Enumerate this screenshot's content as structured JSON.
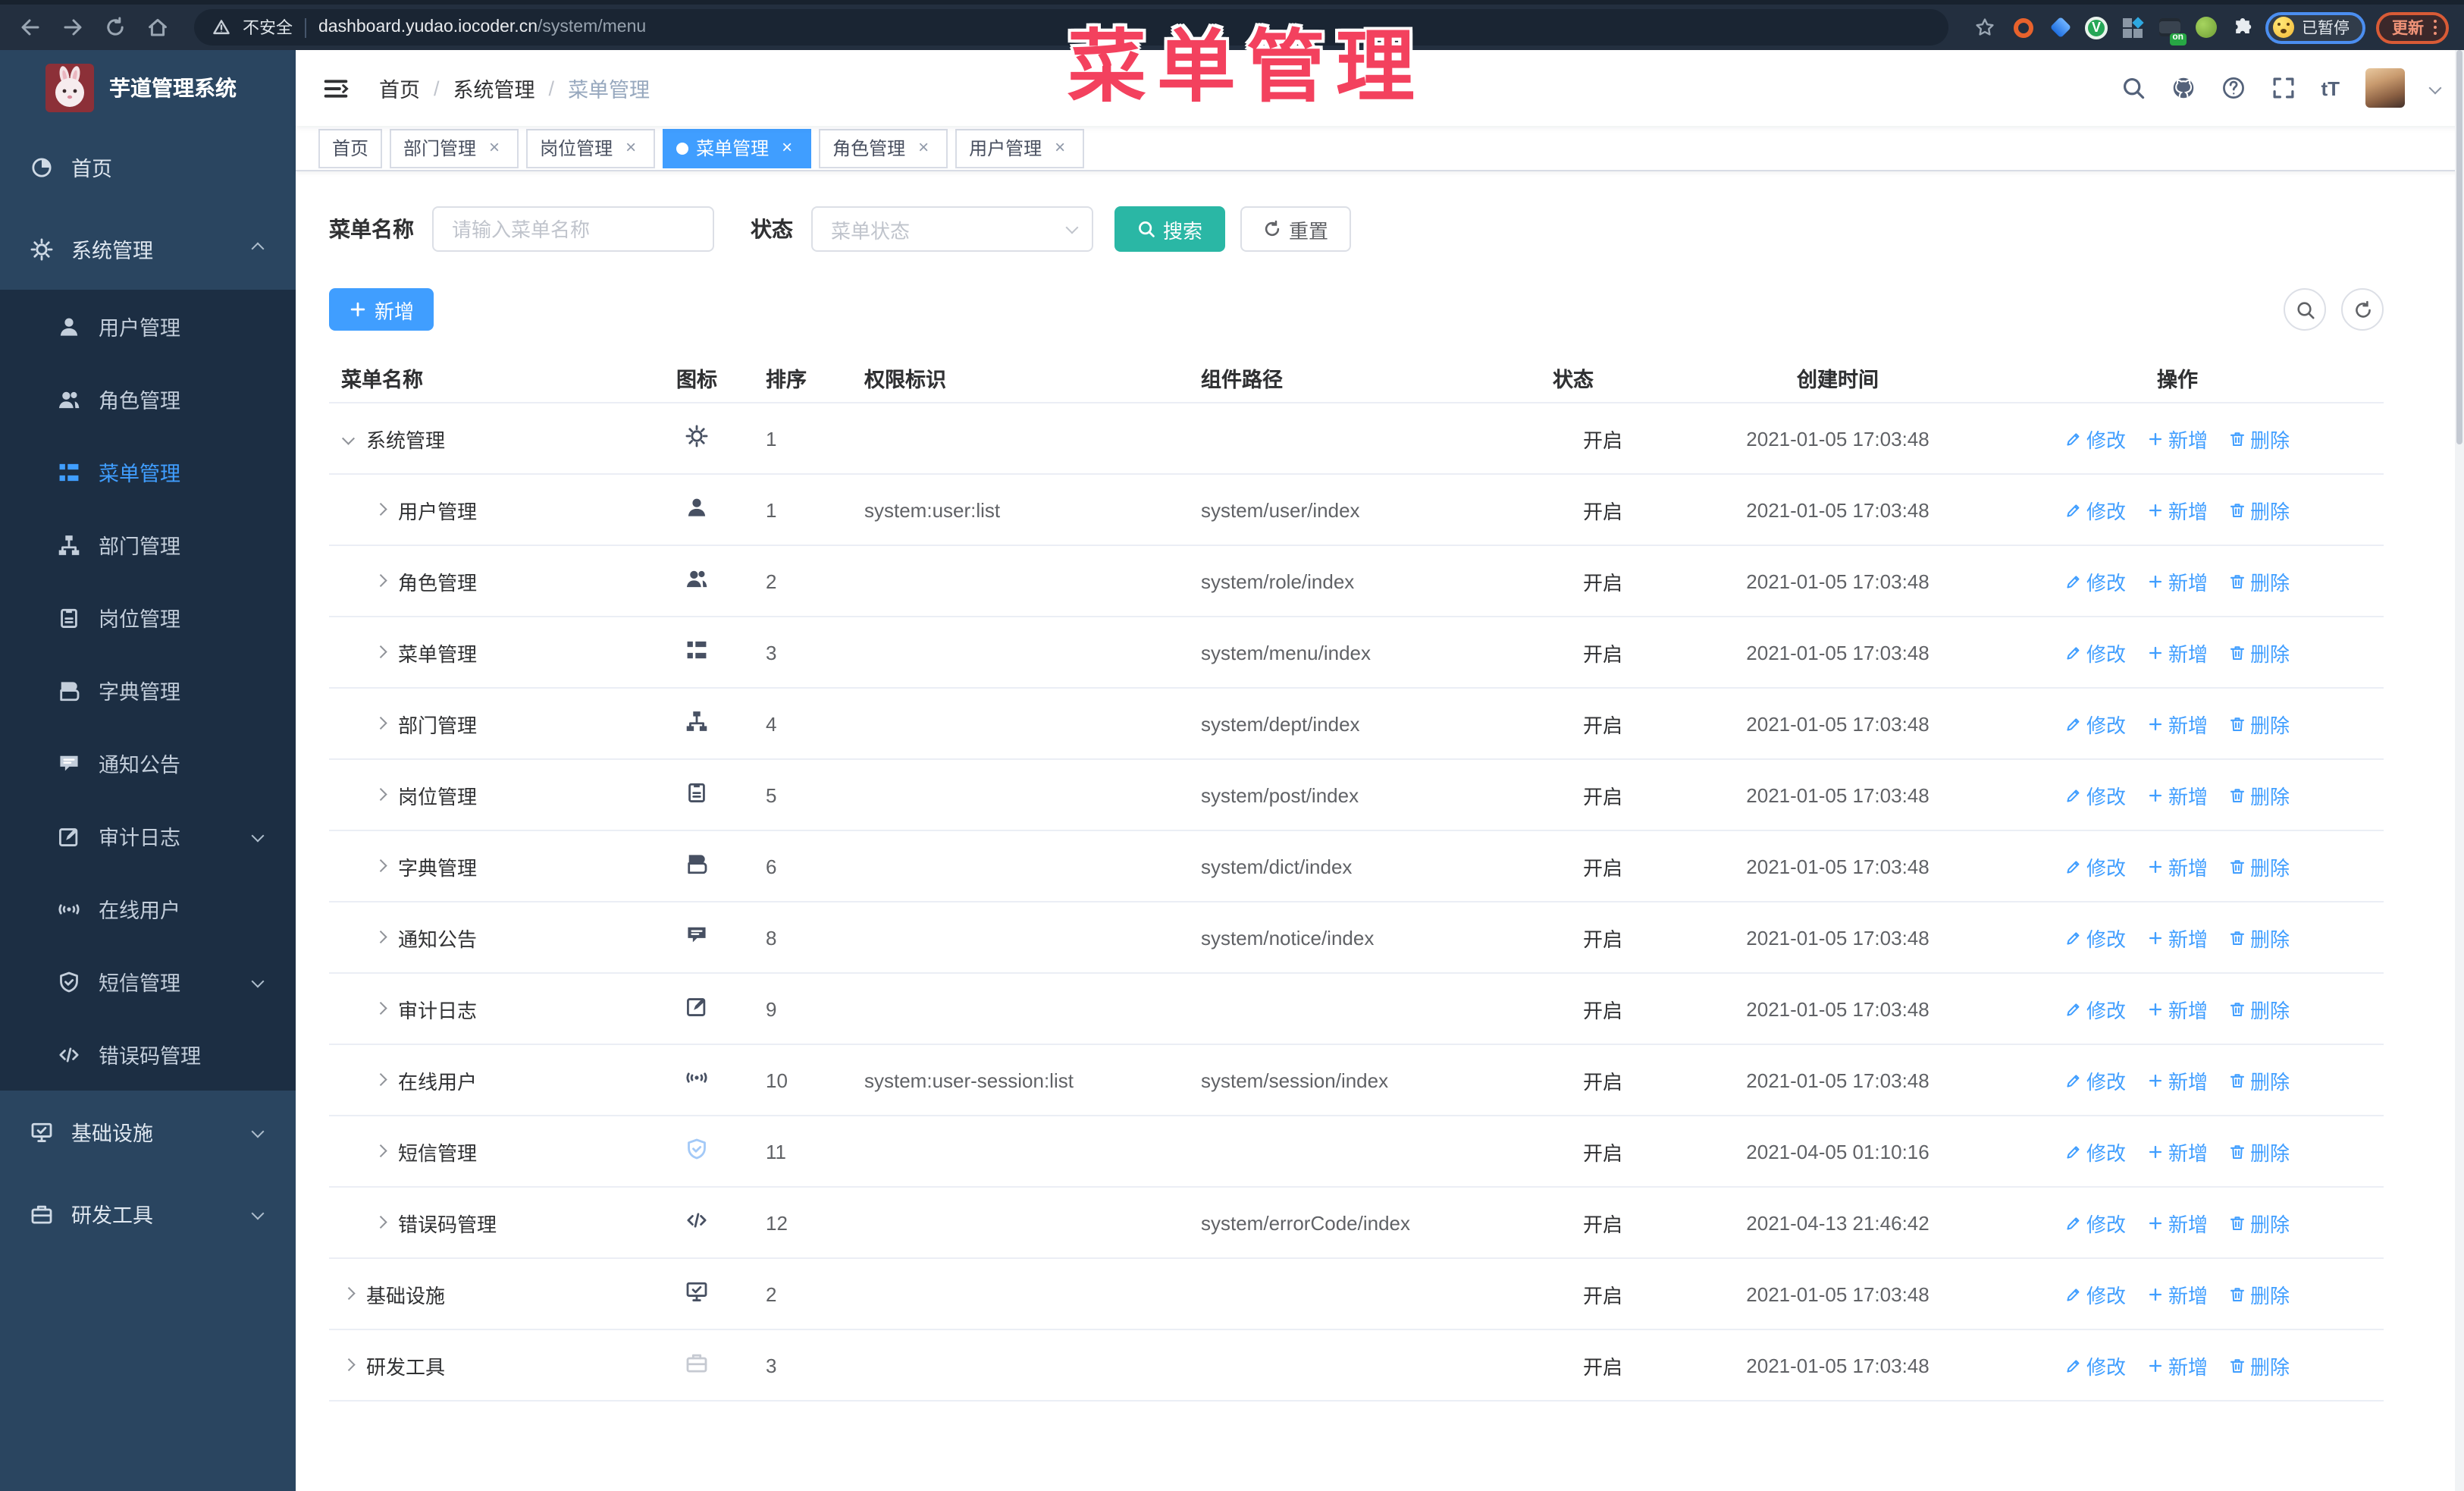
{
  "chrome": {
    "security_label": "不安全",
    "url_host": "dashboard.yudao.iocoder.cn",
    "url_path": "/system/menu",
    "on_badge": "on",
    "paused_label": "已暂停",
    "update_label": "更新"
  },
  "overlay_title": "菜单管理",
  "sidebar": {
    "app_title": "芋道管理系统",
    "groups": [
      {
        "label": "首页",
        "icon": "dashboard"
      },
      {
        "label": "系统管理",
        "icon": "gear",
        "caret": "up"
      },
      {
        "items": [
          {
            "label": "用户管理",
            "icon": "user"
          },
          {
            "label": "角色管理",
            "icon": "users"
          },
          {
            "label": "菜单管理",
            "icon": "menu",
            "active": true
          },
          {
            "label": "部门管理",
            "icon": "tree"
          },
          {
            "label": "岗位管理",
            "icon": "post"
          },
          {
            "label": "字典管理",
            "icon": "dict"
          },
          {
            "label": "通知公告",
            "icon": "notice"
          },
          {
            "label": "审计日志",
            "icon": "log",
            "caret": "down"
          },
          {
            "label": "在线用户",
            "icon": "online"
          },
          {
            "label": "短信管理",
            "icon": "sms",
            "caret": "down"
          },
          {
            "label": "错误码管理",
            "icon": "errcode"
          }
        ]
      },
      {
        "label": "基础设施",
        "icon": "infra",
        "caret": "down"
      },
      {
        "label": "研发工具",
        "icon": "tool",
        "caret": "down"
      }
    ]
  },
  "navbar": {
    "breadcrumb": [
      "首页",
      "系统管理",
      "菜单管理"
    ]
  },
  "tags": [
    {
      "label": "首页"
    },
    {
      "label": "部门管理",
      "closable": true
    },
    {
      "label": "岗位管理",
      "closable": true
    },
    {
      "label": "菜单管理",
      "closable": true,
      "active": true
    },
    {
      "label": "角色管理",
      "closable": true
    },
    {
      "label": "用户管理",
      "closable": true
    }
  ],
  "filters": {
    "name_label": "菜单名称",
    "name_placeholder": "请输入菜单名称",
    "status_label": "状态",
    "status_placeholder": "菜单状态",
    "search_label": "搜索",
    "reset_label": "重置"
  },
  "toolbar": {
    "add_label": "新增"
  },
  "table": {
    "columns": [
      "菜单名称",
      "图标",
      "排序",
      "权限标识",
      "组件路径",
      "状态",
      "创建时间",
      "操作"
    ],
    "action_labels": {
      "edit": "修改",
      "add": "新增",
      "delete": "删除"
    },
    "rows": [
      {
        "name": "系统管理",
        "icon": "gear",
        "expand": "down",
        "level": 0,
        "sort": "1",
        "perm": "",
        "path": "",
        "status": "开启",
        "time": "2021-01-05 17:03:48"
      },
      {
        "name": "用户管理",
        "icon": "user",
        "expand": "right",
        "level": 1,
        "sort": "1",
        "perm": "system:user:list",
        "path": "system/user/index",
        "status": "开启",
        "time": "2021-01-05 17:03:48"
      },
      {
        "name": "角色管理",
        "icon": "users",
        "expand": "right",
        "level": 1,
        "sort": "2",
        "perm": "",
        "path": "system/role/index",
        "status": "开启",
        "time": "2021-01-05 17:03:48"
      },
      {
        "name": "菜单管理",
        "icon": "menu",
        "expand": "right",
        "level": 1,
        "sort": "3",
        "perm": "",
        "path": "system/menu/index",
        "status": "开启",
        "time": "2021-01-05 17:03:48"
      },
      {
        "name": "部门管理",
        "icon": "tree",
        "expand": "right",
        "level": 1,
        "sort": "4",
        "perm": "",
        "path": "system/dept/index",
        "status": "开启",
        "time": "2021-01-05 17:03:48"
      },
      {
        "name": "岗位管理",
        "icon": "post",
        "expand": "right",
        "level": 1,
        "sort": "5",
        "perm": "",
        "path": "system/post/index",
        "status": "开启",
        "time": "2021-01-05 17:03:48"
      },
      {
        "name": "字典管理",
        "icon": "dict",
        "expand": "right",
        "level": 1,
        "sort": "6",
        "perm": "",
        "path": "system/dict/index",
        "status": "开启",
        "time": "2021-01-05 17:03:48"
      },
      {
        "name": "通知公告",
        "icon": "notice",
        "expand": "right",
        "level": 1,
        "sort": "8",
        "perm": "",
        "path": "system/notice/index",
        "status": "开启",
        "time": "2021-01-05 17:03:48"
      },
      {
        "name": "审计日志",
        "icon": "log",
        "expand": "right",
        "level": 1,
        "sort": "9",
        "perm": "",
        "path": "",
        "status": "开启",
        "time": "2021-01-05 17:03:48"
      },
      {
        "name": "在线用户",
        "icon": "online",
        "expand": "right",
        "level": 1,
        "sort": "10",
        "perm": "system:user-session:list",
        "path": "system/session/index",
        "status": "开启",
        "time": "2021-01-05 17:03:48"
      },
      {
        "name": "短信管理",
        "icon": "sms",
        "icon_tint": "light-blue",
        "expand": "right",
        "level": 1,
        "sort": "11",
        "perm": "",
        "path": "",
        "status": "开启",
        "time": "2021-04-05 01:10:16"
      },
      {
        "name": "错误码管理",
        "icon": "errcode",
        "expand": "right",
        "level": 1,
        "sort": "12",
        "perm": "",
        "path": "system/errorCode/index",
        "status": "开启",
        "time": "2021-04-13 21:46:42"
      },
      {
        "name": "基础设施",
        "icon": "infra",
        "expand": "right",
        "level": 0,
        "sort": "2",
        "perm": "",
        "path": "",
        "status": "开启",
        "time": "2021-01-05 17:03:48"
      },
      {
        "name": "研发工具",
        "icon": "tool",
        "icon_tint": "light",
        "expand": "right",
        "level": 0,
        "sort": "3",
        "perm": "",
        "path": "",
        "status": "开启",
        "time": "2021-01-05 17:03:48"
      }
    ]
  }
}
